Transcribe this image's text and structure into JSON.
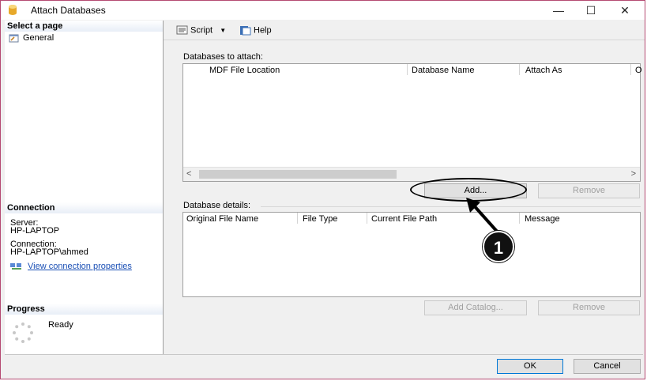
{
  "window": {
    "title": "Attach Databases",
    "minimize_glyph": "—",
    "maximize_glyph": "☐",
    "close_glyph": "✕"
  },
  "sidebar": {
    "select_page_header": "Select a page",
    "pages": [
      {
        "label": "General",
        "icon": "wrench-page-icon"
      }
    ],
    "connection_header": "Connection",
    "server_label": "Server:",
    "server_value": "HP-LAPTOP",
    "connection_label": "Connection:",
    "connection_value": "HP-LAPTOP\\ahmed",
    "view_connection_properties": "View connection properties",
    "progress_header": "Progress",
    "progress_status": "Ready"
  },
  "toolbar": {
    "script_label": "Script",
    "help_label": "Help"
  },
  "databases_to_attach": {
    "label": "Databases to attach:",
    "columns": [
      "MDF File Location",
      "Database Name",
      "Attach As",
      "O"
    ],
    "rows": []
  },
  "attach_buttons": {
    "add": "Add...",
    "remove": "Remove"
  },
  "database_details": {
    "label": "Database details:",
    "columns": [
      "Original File Name",
      "File Type",
      "Current File Path",
      "Message"
    ],
    "rows": []
  },
  "details_buttons": {
    "add_catalog": "Add Catalog...",
    "remove": "Remove"
  },
  "footer": {
    "ok": "OK",
    "cancel": "Cancel"
  },
  "annotation": {
    "step_number": "1"
  },
  "colors": {
    "window_border": "#b54a72",
    "link": "#1a4fb5",
    "ok_border": "#0078d7"
  }
}
